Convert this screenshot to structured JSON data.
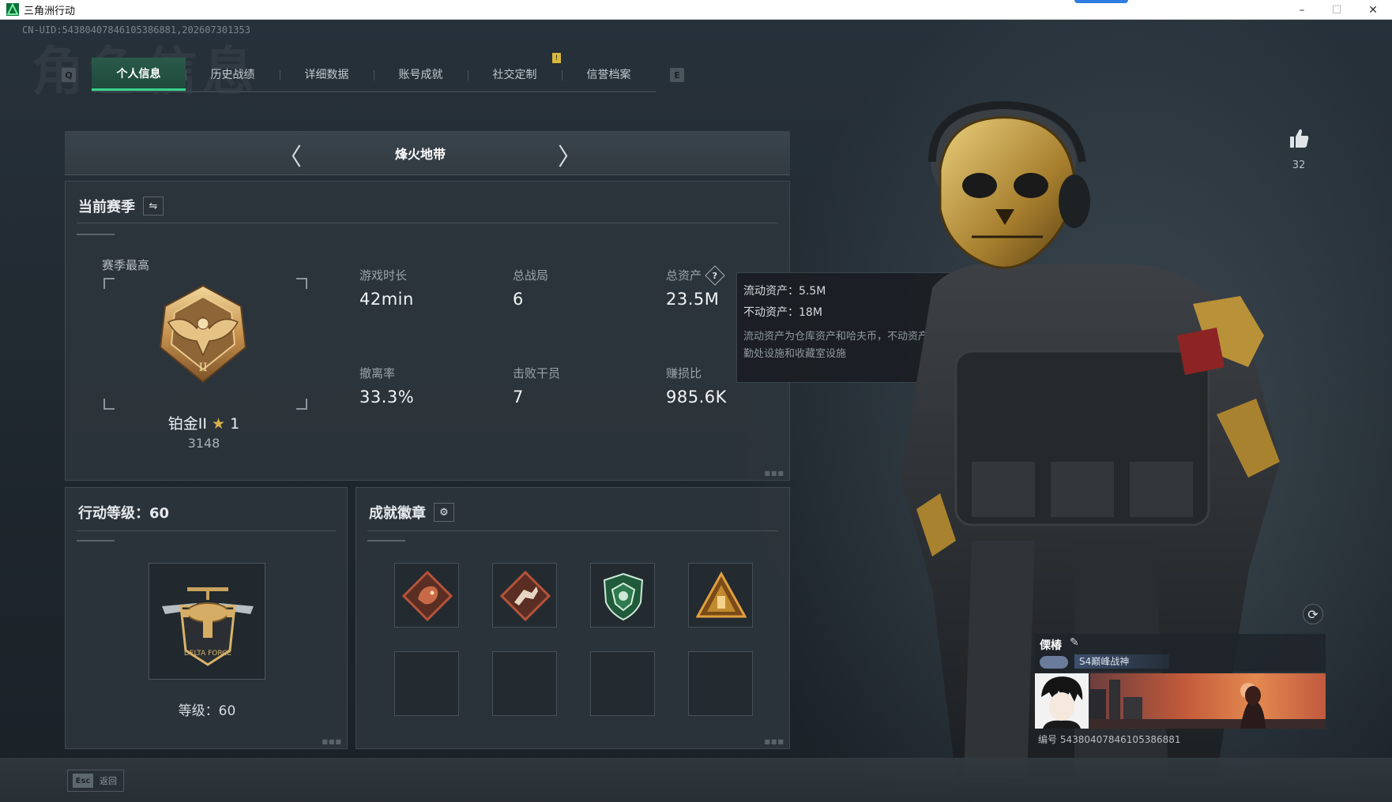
{
  "window": {
    "title": "三角洲行动",
    "min": "–",
    "max": "☐",
    "close": "✕"
  },
  "header": {
    "uid_line": "CN-UID:5438040784610538​6881,202607301353",
    "watermark": "角色信息"
  },
  "tabs": {
    "left_key": "Q",
    "right_key": "E",
    "items": [
      {
        "label": "个人信息"
      },
      {
        "label": "历史战绩"
      },
      {
        "label": "详细数据"
      },
      {
        "label": "账号成就"
      },
      {
        "label": "社交定制"
      },
      {
        "label": "信誉档案"
      }
    ],
    "notify_mark": "!"
  },
  "mode": {
    "name": "烽火地带",
    "prev": "〈",
    "next": "〉"
  },
  "season": {
    "title": "当前赛季",
    "switch_icon": "⇋",
    "peak_label": "赛季最高",
    "rank_name": "铂金II",
    "rank_stars": "1",
    "rank_score": "3148",
    "stats": [
      {
        "label": "游戏时长",
        "value": "42min"
      },
      {
        "label": "总战局",
        "value": "6"
      },
      {
        "label": "总资产",
        "value": "23.5M"
      },
      {
        "label": "撤离率",
        "value": "33.3%"
      },
      {
        "label": "击败干员",
        "value": "7"
      },
      {
        "label": "赚损比",
        "value": "985.6K"
      }
    ],
    "help_mark": "?"
  },
  "tooltip": {
    "line1": "流动资产：5.5M",
    "line2": "不动资产：18M",
    "desc": "流动资产为仓库资产和哈夫币，不动资产为特勤处设施和收藏室设施"
  },
  "level": {
    "title": "行动等级：60",
    "text": "等级：60",
    "emblem_text": "DELTA FORCE"
  },
  "badges": {
    "title": "成就徽章",
    "settings_icon": "⚙",
    "slots": [
      {
        "icon": "dragon-badge-icon",
        "color": "#b5533a"
      },
      {
        "icon": "runner-badge-icon",
        "color": "#b5533a"
      },
      {
        "icon": "shield-badge-icon",
        "color": "#2f7a4e"
      },
      {
        "icon": "triangle-badge-icon",
        "color": "#c08a2e"
      },
      {
        "icon": "empty"
      },
      {
        "icon": "empty"
      },
      {
        "icon": "empty"
      },
      {
        "icon": "empty"
      }
    ]
  },
  "profile": {
    "like_count": "32",
    "name": "傈椿",
    "title_badge": "S4巅峰战神",
    "id_line": "编号 5438040784610538​6881",
    "refresh_icon": "⟳"
  },
  "footer": {
    "esc_key": "Esc",
    "esc_label": "返回"
  },
  "colors": {
    "accent": "#39d48a",
    "gold": "#d7b24a",
    "notify": "#d7b93c"
  }
}
